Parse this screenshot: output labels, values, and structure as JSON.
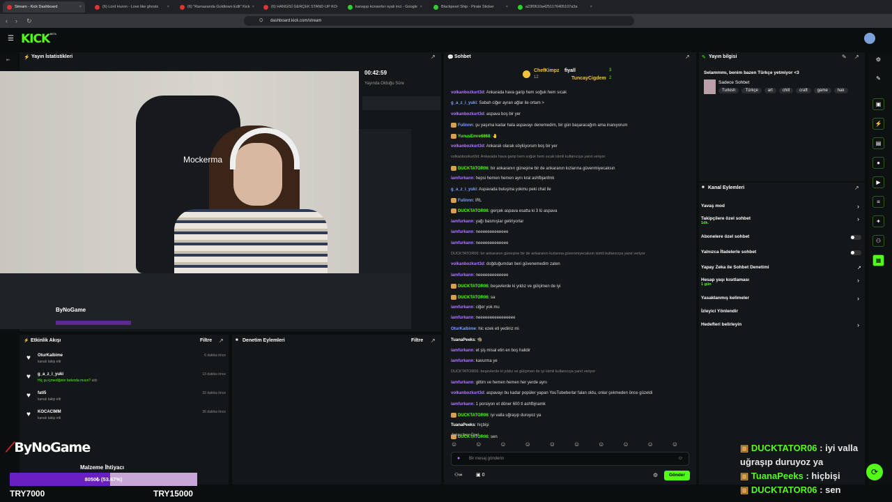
{
  "browser": {
    "tabs": [
      {
        "label": "Stream - Kick Dashboard",
        "active": true
      },
      {
        "label": "(6) Lord Huron - Love like ghosts"
      },
      {
        "label": "(6) \"Ramazanda Goldtown Edit\" Kick"
      },
      {
        "label": "(6) HANGİSİ GERÇEK STAND-UP KO"
      },
      {
        "label": "kanaşıp konserler oyalı inci - Google"
      },
      {
        "label": "Blackpearl Ship - Pirate Sticker"
      },
      {
        "label": "a23f0610a4251176405107a3a"
      }
    ],
    "url": "dashboard.kick.com/stream"
  },
  "kick": {
    "logo": "KICK",
    "beta": "BETA"
  },
  "stats": {
    "title": "Yayın İstatistikleri",
    "time": "00:42:59",
    "time_label": "Yayında Olduğu Süre"
  },
  "video": {
    "overlay_text": "Mockerma"
  },
  "activity": {
    "title": "Etkinlik Akışı",
    "filter": "Filtre",
    "items": [
      {
        "name": "OturKaibime",
        "sub": "kanalı takip etti",
        "time": "6 dakika önce"
      },
      {
        "name": "g_a_z_i_yuki",
        "sub": "Hiç şu içmediğinin farkında mısın?",
        "sub2": "aldı",
        "time": "13 dakika önce"
      },
      {
        "name": "fati5",
        "sub": "kanalı takip etti",
        "time": "32 dakika önce"
      },
      {
        "name": "KOCACIMM",
        "sub": "kanalı takip etti",
        "time": "36 dakika önce"
      }
    ]
  },
  "moderation": {
    "title": "Denetim Eylemleri",
    "filter": "Filtre"
  },
  "chat": {
    "title": "Sohbet",
    "top_users": [
      {
        "name": "ChefKimpz",
        "count": "12"
      },
      {
        "name": "fiyall",
        "count": "3"
      },
      {
        "name": "TuncayCigdem",
        "count": "2"
      }
    ],
    "messages": [
      {
        "user": "volkanbozkurt3d",
        "text": "Ankarada hava garip hem soğuk hem sıcak",
        "color": "#b57aff"
      },
      {
        "user": "g_a_z_i_yuki",
        "text": "Sabah ciğer ayran ağlar ile ortam >",
        "color": "#7aa2ff"
      },
      {
        "user": "volkanbozkurt3d",
        "text": "aspava boş bir yer",
        "color": "#b57aff"
      },
      {
        "user": "Fulinnn",
        "text": "şu yaşıma kadar hala aspavayı denemedim, bir gün başaracağım ama inanıyorum",
        "color": "#7aa2ff"
      },
      {
        "user": "YunusEmre6868",
        "text": "🤚",
        "color": "#53fc18"
      },
      {
        "user": "volkanbozkurt3d",
        "text": "Ankaralı olarak söylüyorum boş bir yer",
        "color": "#b57aff"
      },
      {
        "user": "",
        "text": "volkanbozkurt3d: Ankarada hava garip hem soğuk hem sıcak isimli kullanıcıya yanıt veriyor",
        "color": "#888",
        "sys": true
      },
      {
        "user": "DUCKTATOR06",
        "text": "bir ankaranın güneşine bir de ankaranın kızlarına güvenmiyecaksın",
        "color": "#53fc18"
      },
      {
        "user": "iamfurkann",
        "text": "hepsi hemen hemen aynı kral ashfbjanfmk",
        "color": "#b57aff"
      },
      {
        "user": "g_a_z_i_yuki",
        "text": "Aspavada buluşma yokmu peki chat ile",
        "color": "#7aa2ff"
      },
      {
        "user": "Fulinnn",
        "text": "IRL",
        "color": "#7aa2ff"
      },
      {
        "user": "DUCKTATOR06",
        "text": "gerçek aspava esatta ki 3 lü aspava",
        "color": "#53fc18"
      },
      {
        "user": "iamfurkann",
        "text": "yağı basmışlar getiriyorlar",
        "color": "#b57aff"
      },
      {
        "user": "iamfurkann",
        "text": "neeeeeeeeeeeee",
        "color": "#b57aff"
      },
      {
        "user": "iamfurkann",
        "text": "neeeeeeeeeeeee",
        "color": "#b57aff"
      },
      {
        "user": "",
        "text": "DUCKTATOR06: bir ankaranın güneşine bir de ankaranın kızlarına güvenmiyecaksın isimli kullanıcıya yanıt veriyor",
        "color": "#888",
        "sys": true
      },
      {
        "user": "volkanbozkurt3d",
        "text": "doğduğumdan beri güvenemedim zaten",
        "color": "#b57aff"
      },
      {
        "user": "iamfurkann",
        "text": "neeeeeeeeeeeee",
        "color": "#b57aff"
      },
      {
        "user": "DUCKTATOR06",
        "text": "beşevlerde ki yıldız ve gülçimen de iyi",
        "color": "#53fc18"
      },
      {
        "user": "DUCKTATOR06",
        "text": "sa",
        "color": "#53fc18"
      },
      {
        "user": "iamfurkann",
        "text": "ciğer yok mu",
        "color": "#b57aff"
      },
      {
        "user": "iamfurkann",
        "text": "neeeeeeeeeeeeeeee",
        "color": "#b57aff"
      },
      {
        "user": "OturKaibime",
        "text": "hic ezek eti yediniz mi",
        "color": "#7aa2ff"
      },
      {
        "user": "TuanaPeeks",
        "text": "🧌",
        "color": "#ffffff"
      },
      {
        "user": "iamfurkann",
        "text": "et şiş misal etin en boş halidir",
        "color": "#b57aff"
      },
      {
        "user": "iamfurkann",
        "text": "kavurma ye",
        "color": "#b57aff"
      },
      {
        "user": "",
        "text": "DUCKTATOR06: beşevlerde ki yıldız ve gülçimen de iyi isimli kullanıcıya yanıt veriyor",
        "color": "#888",
        "sys": true
      },
      {
        "user": "iamfurkann",
        "text": "gittim ve hemen hemen her yerde aynı",
        "color": "#b57aff"
      },
      {
        "user": "volkanbozkurt3d",
        "text": "aspavayı bu kadar popüler yapan YouTubeberlar falan oldu, onlar çekmeden önce güzeldi",
        "color": "#b57aff"
      },
      {
        "user": "iamfurkann",
        "text": "1 porsiyon et döner 600 tl ashfbjnamk",
        "color": "#b57aff"
      },
      {
        "user": "DUCKTATOR06",
        "text": "iyi valla uğraşıp duruyoz ya",
        "color": "#53fc18"
      },
      {
        "user": "TuanaPeeks",
        "text": "hiçbişi",
        "color": "#ffffff"
      },
      {
        "user": "DUCKTATOR06",
        "text": "sen",
        "color": "#53fc18"
      }
    ],
    "followers_only": "Takipçilere Özel",
    "input_placeholder": "Bir mesaj gönderin",
    "send": "Gönder",
    "viewer_count": "0"
  },
  "info": {
    "title": "Yayın bilgisi",
    "stream_title": "Selammmı, benim bazen Türkçe yetmiyor <3",
    "category": "Sadece Sohbet",
    "tags": [
      "Turkish",
      "Türkçe",
      "art",
      "chill",
      "craft",
      "game",
      "hak"
    ]
  },
  "channel_actions": {
    "title": "Kanal Eylemleri",
    "items": [
      {
        "label": "Yavaş mod",
        "kind": "chev"
      },
      {
        "label": "Takipçilere özel sohbet",
        "sub": "1dk.",
        "kind": "chev"
      },
      {
        "label": "Abonelere özel sohbet",
        "kind": "toggle"
      },
      {
        "label": "Yalnızca İfadelerle sohbet",
        "kind": "toggle"
      },
      {
        "label": "Yapay Zeka ile Sohbet Denetimi",
        "kind": "ext"
      },
      {
        "label": "Hesap yaşı kısıtlaması",
        "sub": "1 gün",
        "kind": "chev"
      },
      {
        "label": "Yasaklanmış kelimeler",
        "kind": "chev"
      },
      {
        "label": "İzleyici Yönlendir",
        "kind": "none"
      },
      {
        "label": "Hedefleri belirleyin",
        "kind": "chev"
      }
    ]
  },
  "overlay": {
    "brand": "ByNoGame",
    "goal_title": "Malzeme İhtiyacı",
    "goal_text": "8050₺ (53.67%)",
    "goal_fraction": 0.5367,
    "goal_min": "TRY7000",
    "goal_max": "TRY15000",
    "chat": [
      {
        "user": "DUCKTATOR06",
        "text": "iyi valla uğraşıp duruyoz ya"
      },
      {
        "user": "TuanaPeeks",
        "text": "hiçbişi"
      },
      {
        "user": "DUCKTATOR06",
        "text": "sen"
      }
    ]
  }
}
